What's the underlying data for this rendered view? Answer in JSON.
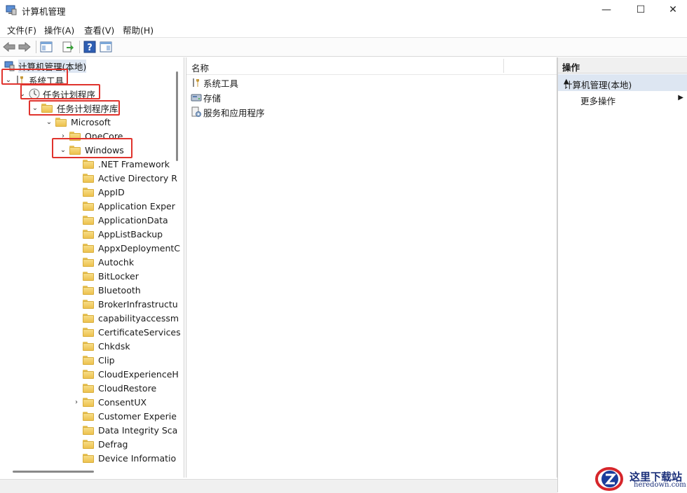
{
  "window": {
    "title": "计算机管理",
    "controls": {
      "minimize": "—",
      "maximize": "☐",
      "close": "✕"
    }
  },
  "menu": [
    "文件(F)",
    "操作(A)",
    "查看(V)",
    "帮助(H)"
  ],
  "tree": {
    "root": "计算机管理(本地)",
    "system_tools": "系统工具",
    "task_scheduler": "任务计划程序",
    "task_library": "任务计划程序库",
    "microsoft": "Microsoft",
    "onecore": "OneCore",
    "windows": "Windows",
    "children": [
      ".NET Framework",
      "Active Directory R",
      "AppID",
      "Application Exper",
      "ApplicationData",
      "AppListBackup",
      "AppxDeploymentC",
      "Autochk",
      "BitLocker",
      "Bluetooth",
      "BrokerInfrastructu",
      "capabilityaccessm",
      "CertificateServices",
      "Chkdsk",
      "Clip",
      "CloudExperienceH",
      "CloudRestore",
      "ConsentUX",
      "Customer Experie",
      "Data Integrity Sca",
      "Defrag",
      "Device Informatio"
    ]
  },
  "middle": {
    "column_header": "名称",
    "items": [
      "系统工具",
      "存储",
      "服务和应用程序"
    ]
  },
  "actions": {
    "header": "操作",
    "group": "计算机管理(本地)",
    "item": "更多操作"
  },
  "watermark": {
    "title": "这里下载站",
    "url": "heredown.com"
  },
  "colors": {
    "highlight": "#e0332d",
    "selection": "#dde6f2"
  }
}
